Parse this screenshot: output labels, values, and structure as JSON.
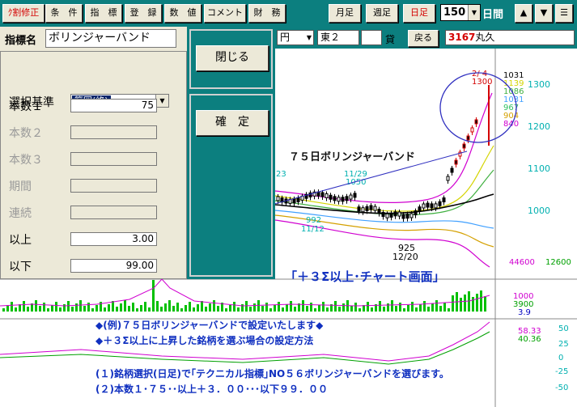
{
  "toolbar": {
    "buttons": [
      {
        "label": "ｸ割修正",
        "red": true
      },
      {
        "label": "条　件",
        "red": false
      },
      {
        "label": "指　標",
        "red": false
      },
      {
        "label": "登　録",
        "red": false
      },
      {
        "label": "数　値",
        "red": false
      },
      {
        "label": "コメント",
        "red": false
      },
      {
        "label": "財　務",
        "red": false
      }
    ],
    "period_buttons": [
      {
        "label": "月足",
        "red": false
      },
      {
        "label": "週足",
        "red": false
      },
      {
        "label": "日足",
        "red": true
      }
    ],
    "count_value": "150",
    "count_unit": "日間",
    "up_icon": "▲",
    "down_icon": "▼",
    "menu_icon": "☰"
  },
  "stock_bar": {
    "currency": "円",
    "market": "東２",
    "blank1": "",
    "lending": "貸",
    "back_button": "戻る",
    "code": "3167",
    "name": "丸久"
  },
  "dialog": {
    "name_label": "指標名",
    "name_value": "ボリンジャーバンド",
    "close_button": "閉じる",
    "confirm_button": "確　定",
    "select_label": "選択基準",
    "select_value": "範囲(終)",
    "fields": [
      {
        "label": "本数１",
        "value": "75",
        "disabled": false
      },
      {
        "label": "本数２",
        "value": "",
        "disabled": true
      },
      {
        "label": "本数３",
        "value": "",
        "disabled": true
      },
      {
        "label": "期間",
        "value": "",
        "disabled": true
      },
      {
        "label": "連続",
        "value": "",
        "disabled": true
      },
      {
        "label": "以上",
        "value": "3.00",
        "disabled": false
      },
      {
        "label": "以下",
        "value": "99.00",
        "disabled": false
      }
    ]
  },
  "chart": {
    "annotations": {
      "bb_title": "７５日ボリンジャーバンド",
      "screen_title": "「＋３Σ以上･チャート画面」",
      "note1": "◆(例)７５日ボリンジャーバンドで設定いたします◆",
      "note2": "◆＋３Σ以上に上昇した銘柄を選ぶ場合の設定方法",
      "note3": "(１)銘柄選択(日足)で｢テクニカル指標｣NO５６ボリンジャーバンドを選びます。",
      "note4": "(２)本数１･７５･･以上＋３．００･･･以下９９．００"
    },
    "peak_date": "2/ 4",
    "peak_price": "1300",
    "band_values": [
      "1031",
      "1139",
      "1086",
      "1031",
      "967",
      "904",
      "840"
    ],
    "band_colors": [
      "#000000",
      "#d4d400",
      "#40b040",
      "#40a0ff",
      "#30c060",
      "#d4a000",
      "#d000d0"
    ],
    "price_axis": [
      "1300",
      "1200",
      "1100",
      "1000"
    ],
    "labels_left": {
      "a": "23",
      "b": "11/29",
      "c": "1050",
      "d": "992",
      "e": "11/12",
      "f": "925",
      "g": "12/20"
    },
    "volume_axis": {
      "top_magenta": "44600",
      "top_green": "12600",
      "v1": "1000",
      "v2": "3900",
      "v3": "3.9"
    },
    "osc_axis": [
      "50",
      "25",
      "0",
      "-25",
      "-50"
    ],
    "osc_values": {
      "a": "58.33",
      "b": "40.36"
    }
  }
}
